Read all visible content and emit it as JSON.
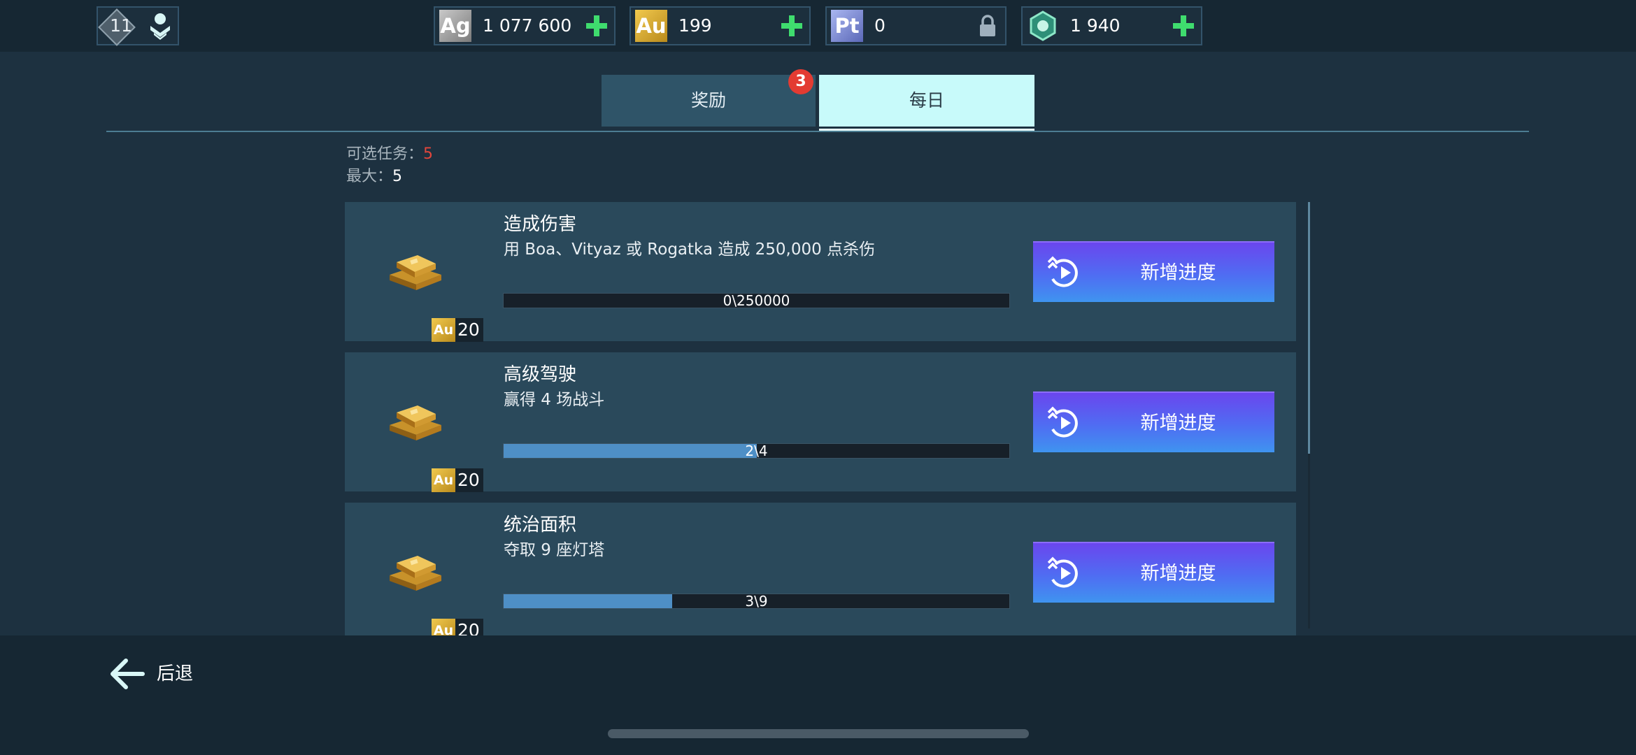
{
  "top_bar": {
    "level": "11",
    "currencies": [
      {
        "code": "Ag",
        "value": "1 077 600",
        "action": "add"
      },
      {
        "code": "Au",
        "value": "199",
        "action": "add"
      },
      {
        "code": "Pt",
        "value": "0",
        "action": "locked"
      },
      {
        "code": "gem",
        "value": "1 940",
        "action": "add"
      }
    ]
  },
  "tabs": {
    "rewards_label": "奖励",
    "rewards_badge": "3",
    "daily_label": "每日",
    "active": "daily"
  },
  "counters": {
    "available_label": "可选任务：",
    "available_value": "5",
    "max_label": "最大：",
    "max_value": "5"
  },
  "tasks": [
    {
      "title": "造成伤害",
      "description": "用 Boa、Vityaz 或 Rogatka 造成 250,000 点杀伤",
      "progress_text": "0\\250000",
      "progress_fraction": 0,
      "reward_currency": "Au",
      "reward_amount": "20",
      "button_label": "新增进度"
    },
    {
      "title": "高级驾驶",
      "description": "赢得 4 场战斗",
      "progress_text": "2\\4",
      "progress_fraction": 0.5,
      "reward_currency": "Au",
      "reward_amount": "20",
      "button_label": "新增进度"
    },
    {
      "title": "统治面积",
      "description": "夺取 9 座灯塔",
      "progress_text": "3\\9",
      "progress_fraction": 0.3333,
      "reward_currency": "Au",
      "reward_amount": "20",
      "button_label": "新增进度"
    }
  ],
  "footer": {
    "back_label": "后退"
  },
  "colors": {
    "background": "#1d3140",
    "bar": "#162733",
    "card": "#2a495b",
    "active_tab": "#c8fafa",
    "progress_fill": "#4e8fc6",
    "button_top": "#6a46ee",
    "button_bottom": "#3f94f0",
    "badge_red": "#e33b32",
    "add_green": "#3fdc6e"
  }
}
